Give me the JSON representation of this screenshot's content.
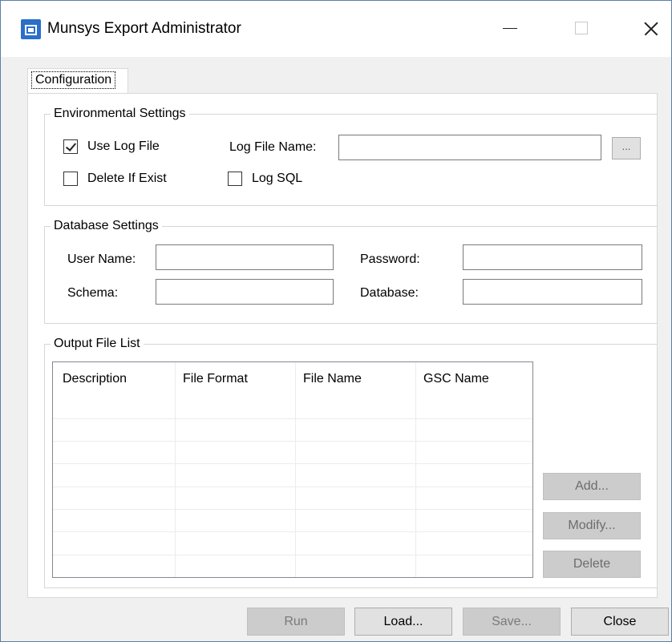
{
  "window": {
    "title": "Munsys Export Administrator"
  },
  "tabs": [
    {
      "label": "Configuration"
    }
  ],
  "environmental": {
    "legend": "Environmental Settings",
    "use_log_file": {
      "label": "Use Log File",
      "checked": true
    },
    "delete_if_exist": {
      "label": "Delete If Exist",
      "checked": false
    },
    "log_sql": {
      "label": "Log SQL",
      "checked": false
    },
    "log_file_name": {
      "label": "Log File Name:",
      "value": ""
    },
    "browse_label": "..."
  },
  "database": {
    "legend": "Database Settings",
    "user_name": {
      "label": "User Name:",
      "value": ""
    },
    "password": {
      "label": "Password:",
      "value": ""
    },
    "schema": {
      "label": "Schema:",
      "value": ""
    },
    "database": {
      "label": "Database:",
      "value": ""
    }
  },
  "output": {
    "legend": "Output File List",
    "columns": [
      "Description",
      "File Format",
      "File Name",
      "GSC Name"
    ],
    "rows": [],
    "buttons": {
      "add": "Add...",
      "modify": "Modify...",
      "delete": "Delete"
    }
  },
  "footer": {
    "run": "Run",
    "load": "Load...",
    "save": "Save...",
    "close": "Close"
  }
}
